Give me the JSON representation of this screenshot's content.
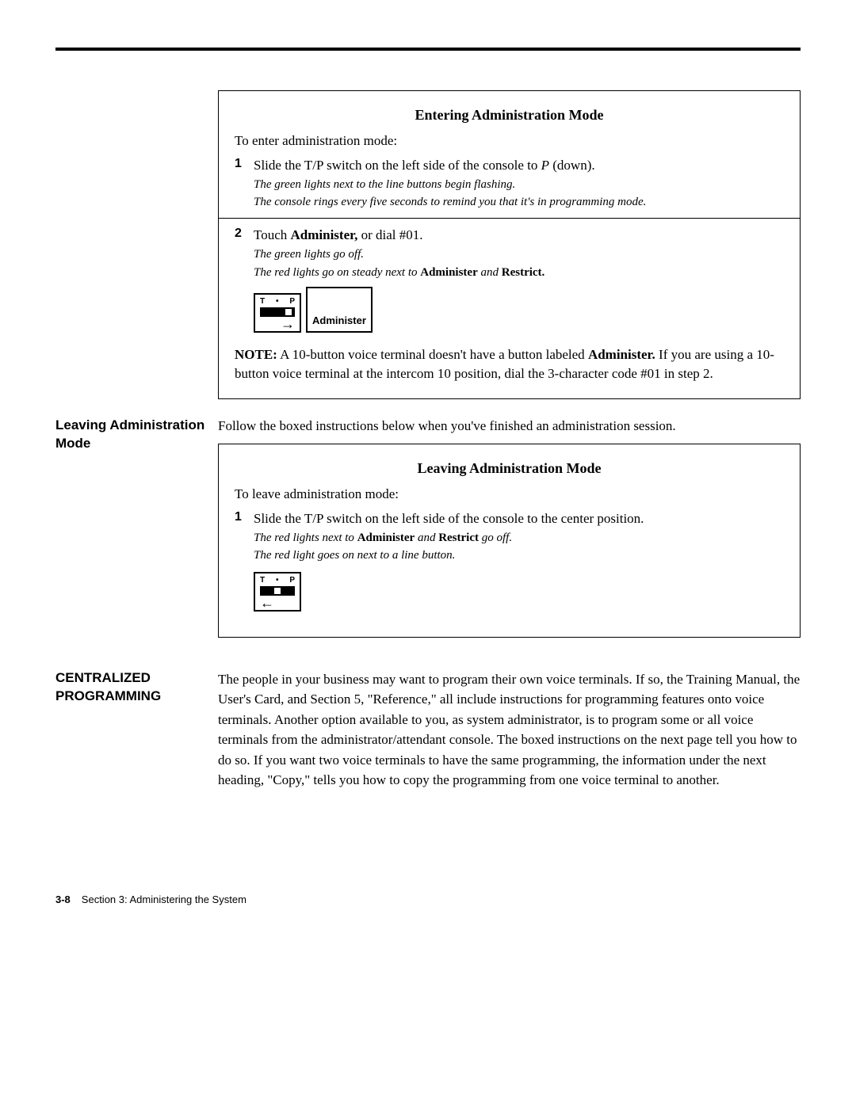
{
  "box1": {
    "title": "Entering Administration Mode",
    "intro": "To enter administration mode:",
    "step1_num": "1",
    "step1_main_a": "Slide the T/P switch on the left side of the console to ",
    "step1_main_p": "P",
    "step1_main_b": " (down).",
    "step1_sub1": "The green lights next to the line buttons begin flashing.",
    "step1_sub2": "The console rings every five seconds to remind you that it's in programming mode.",
    "step2_num": "2",
    "step2_main_a": "Touch ",
    "step2_main_b": "Administer,",
    "step2_main_c": " or dial #01.",
    "step2_sub1": "The green lights go off.",
    "step2_sub2_a": "The red lights go on steady next to ",
    "step2_sub2_b": "Administer",
    "step2_sub2_c": " and ",
    "step2_sub2_d": "Restrict.",
    "switch_t": "T",
    "switch_p": "P",
    "admin_key": "Administer",
    "note_label": "NOTE:",
    "note_a": " A 10-button voice terminal doesn't have a button labeled ",
    "note_b": "Administer.",
    "note_c": " If you are using a 10-button voice terminal at the intercom 10 position, dial the 3-character code #01 in step 2."
  },
  "section_leave": {
    "heading": "Leaving Administration Mode",
    "para": "Follow the boxed instructions below when you've finished an administration session."
  },
  "box2": {
    "title": "Leaving Administration Mode",
    "intro": "To leave administration mode:",
    "step1_num": "1",
    "step1_main": "Slide the T/P switch on the left side of the console to the center position.",
    "step1_sub1_a": "The red lights next to ",
    "step1_sub1_b": "Administer",
    "step1_sub1_c": " and ",
    "step1_sub1_d": "Restrict",
    "step1_sub1_e": " go off.",
    "step1_sub2": "The red light goes on next to a line button.",
    "switch_t": "T",
    "switch_p": "P"
  },
  "section_central": {
    "heading": "CENTRALIZED PROGRAMMING",
    "para": "The people in your business may want to program their own voice terminals. If so, the Training Manual, the User's Card, and Section 5, \"Reference,\" all include instructions for programming features onto voice terminals. Another option available to you, as system administrator, is to program some or all voice terminals from the administrator/attendant console. The boxed instructions on the next page tell you how to do so. If you want two voice terminals to have the same programming, the information under the next heading, \"Copy,\" tells you how to copy the programming from one voice terminal to another."
  },
  "footer": {
    "page": "3-8",
    "section": "Section 3: Administering the System"
  }
}
